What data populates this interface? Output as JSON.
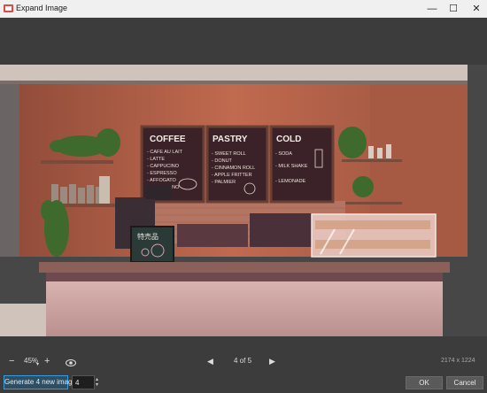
{
  "window": {
    "title": "Expand Image",
    "minimize": "—",
    "maximize": "☐",
    "close": "✕"
  },
  "scene": {
    "menu_boards": [
      {
        "heading": "COFFEE",
        "items": [
          "- CAFE AU LAIT",
          "- LATTE",
          "- CAPPUCINO",
          "- ESPRESSO",
          "- AFFOGATO",
          "- AMERICANO"
        ]
      },
      {
        "heading": "PASTRY",
        "items": [
          "- SWEET ROLL",
          "- DONUT",
          "- CINNAMON ROLL",
          "- APPLE FRITTER",
          "- PALMIER"
        ]
      },
      {
        "heading": "COLD",
        "items": [
          "- SODA",
          "- MILK SHAKE",
          "- LEMONADE"
        ]
      }
    ],
    "chalk_sign": "特売品"
  },
  "toolbar": {
    "zoom_out": "−",
    "zoom_level": "45%",
    "zoom_in": "+",
    "prev": "◀",
    "page_indicator": "4 of 5",
    "next": "▶",
    "dimensions": "2174 x 1224"
  },
  "bottom": {
    "generate_label": "Generate 4 new images",
    "count_value": "4",
    "ok_label": "OK",
    "cancel_label": "Cancel"
  },
  "colors": {
    "accent": "#3a9bd9",
    "wall": "#b5634a",
    "board": "#3a2228"
  }
}
